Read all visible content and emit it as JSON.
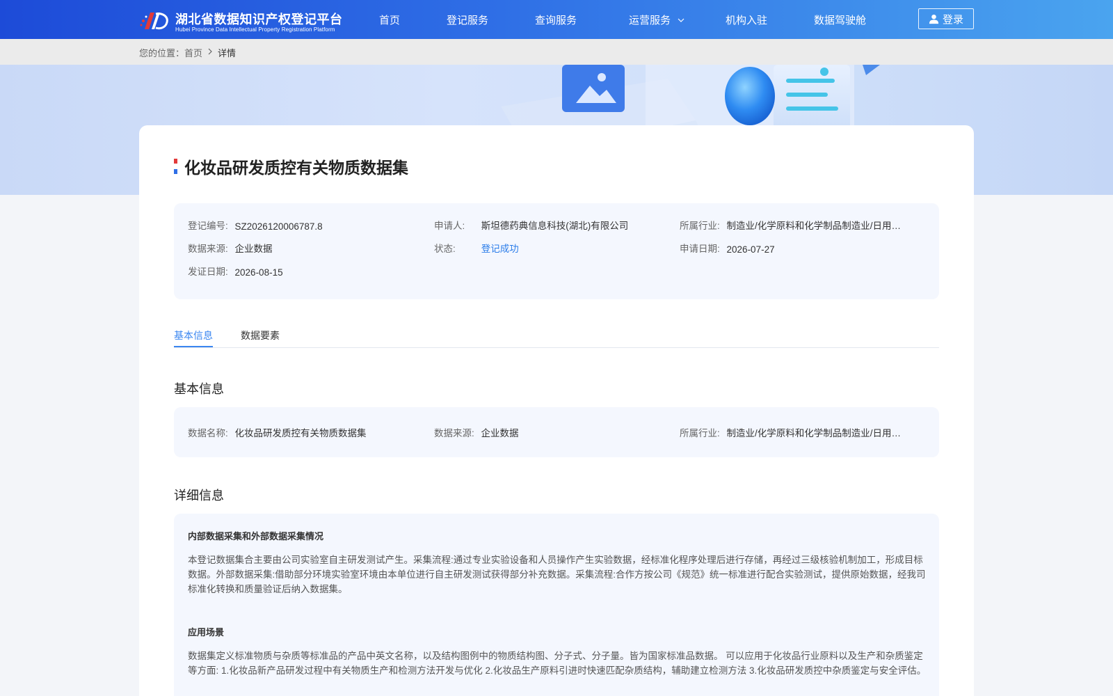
{
  "header": {
    "logo_cn": "湖北省数据知识产权登记平台",
    "logo_en": "Hubei Province Data Intellectual Property Registration Platform",
    "nav": [
      "首页",
      "登记服务",
      "查询服务",
      "运营服务",
      "机构入驻",
      "数据驾驶舱"
    ],
    "login_label": "登录",
    "colors": {
      "start": "#1d4bd8",
      "end": "#4aa4ef"
    }
  },
  "breadcrumb": {
    "prefix": "您的位置：",
    "home": "首页",
    "current": "详情"
  },
  "title": "化妆品研发质控有关物质数据集",
  "summary": {
    "reg_no_label": "登记编号:",
    "reg_no": "SZ2026120006787.8",
    "applicant_label": "申请人:",
    "applicant": "斯坦德药典信息科技(湖北)有限公司",
    "industry_label": "所属行业:",
    "industry": "制造业/化学原料和化学制品制造业/日用…",
    "source_label": "数据来源:",
    "source": "企业数据",
    "status_label": "状态:",
    "status": "登记成功",
    "apply_date_label": "申请日期:",
    "apply_date": "2026-07-27",
    "cert_date_label": "发证日期:",
    "cert_date": "2026-08-15"
  },
  "tabs": [
    "基本信息",
    "数据要素"
  ],
  "basic": {
    "heading": "基本信息",
    "name_label": "数据名称:",
    "name": "化妆品研发质控有关物质数据集",
    "source_label": "数据来源:",
    "source": "企业数据",
    "industry_label": "所属行业:",
    "industry": "制造业/化学原料和化学制品制造业/日用…"
  },
  "detail": {
    "heading": "详细信息",
    "collect_title": "内部数据采集和外部数据采集情况",
    "collect_text": "本登记数据集合主要由公司实验室自主研发测试产生。采集流程:通过专业实验设备和人员操作产生实验数据，经标准化程序处理后进行存储，再经过三级核验机制加工，形成目标数据。外部数据采集:借助部分环境实验室环境由本单位进行自主研发测试获得部分补充数据。采集流程:合作方按公司《规范》统一标准进行配合实验测试，提供原始数据，经我司标准化转换和质量验证后纳入数据集。",
    "scene_title": "应用场景",
    "scene_text": "数据集定义标准物质与杂质等标准品的产品中英文名称，以及结构图例中的物质结构图、分子式、分子量。皆为国家标准品数据。 可以应用于化妆品行业原料以及生产和杂质鉴定等方面: 1.化妆品新产品研发过程中有关物质生产和检测方法开发与优化 2.化妆品生产原料引进时快速匹配杂质结构，辅助建立检测方法 3.化妆品研发质控中杂质鉴定与安全评估。"
  }
}
